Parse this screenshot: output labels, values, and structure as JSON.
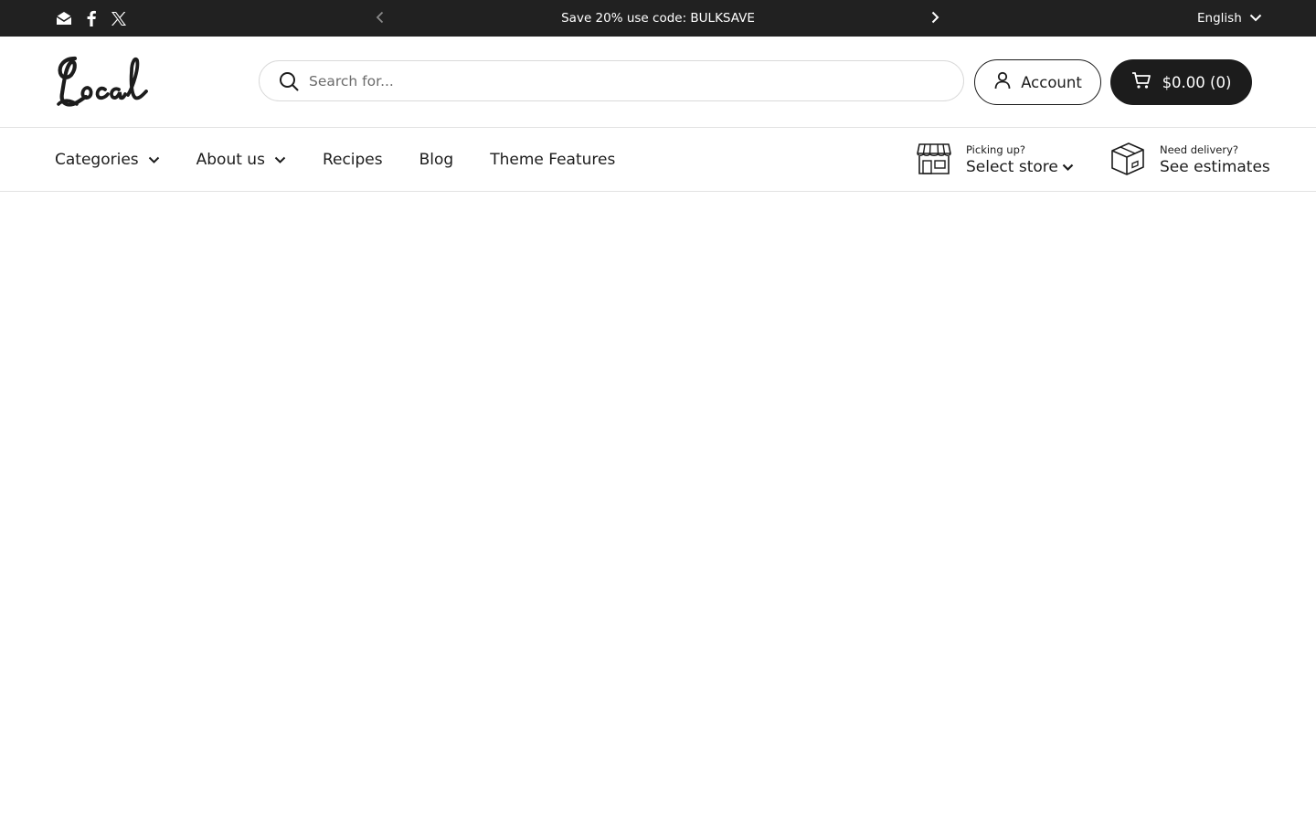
{
  "announcement": {
    "social_icons": [
      "email-icon",
      "facebook-icon",
      "x-twitter-icon"
    ],
    "message": "Save 20% use code: BULKSAVE",
    "language": "English"
  },
  "header": {
    "logo_text": "Local",
    "search": {
      "placeholder": "Search for...",
      "value": ""
    },
    "account_label": "Account",
    "cart_label": "$0.00 (0)"
  },
  "nav": {
    "items": [
      {
        "label": "Categories",
        "has_dropdown": true
      },
      {
        "label": "About us",
        "has_dropdown": true
      },
      {
        "label": "Recipes",
        "has_dropdown": false
      },
      {
        "label": "Blog",
        "has_dropdown": false
      },
      {
        "label": "Theme Features",
        "has_dropdown": false
      }
    ],
    "pickup": {
      "small": "Picking up?",
      "big": "Select store"
    },
    "delivery": {
      "small": "Need delivery?",
      "big": "See estimates"
    }
  },
  "colors": {
    "announcement_bg": "#212121",
    "text": "#1c1c1c",
    "cart_bg": "#1c1c1c",
    "border": "#e2e2e2"
  }
}
